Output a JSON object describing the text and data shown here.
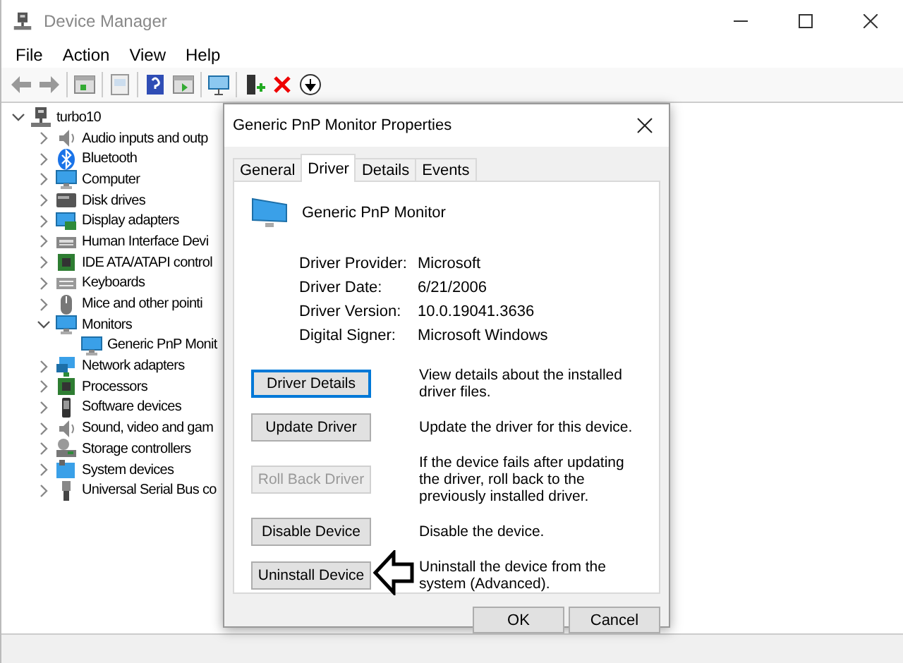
{
  "window": {
    "title": "Device Manager"
  },
  "menu": [
    "File",
    "Action",
    "View",
    "Help"
  ],
  "tree": [
    {
      "label": "turbo10",
      "kind": "computer",
      "expanded": true,
      "children": [
        {
          "label": "Audio inputs and outp",
          "kind": "speaker",
          "expanded": false
        },
        {
          "label": "Bluetooth",
          "kind": "bluetooth",
          "expanded": false
        },
        {
          "label": "Computer",
          "kind": "monitor",
          "expanded": false
        },
        {
          "label": "Disk drives",
          "kind": "disk",
          "expanded": false
        },
        {
          "label": "Display adapters",
          "kind": "adapter",
          "expanded": false
        },
        {
          "label": "Human Interface Devi",
          "kind": "hid",
          "expanded": false
        },
        {
          "label": "IDE ATA/ATAPI control",
          "kind": "chip",
          "expanded": false
        },
        {
          "label": "Keyboards",
          "kind": "keyboard",
          "expanded": false
        },
        {
          "label": "Mice and other pointi",
          "kind": "mouse",
          "expanded": false
        },
        {
          "label": "Monitors",
          "kind": "monitor",
          "expanded": true,
          "children": [
            {
              "label": "Generic PnP Monit",
              "kind": "monitor"
            }
          ]
        },
        {
          "label": "Network adapters",
          "kind": "network",
          "expanded": false
        },
        {
          "label": "Processors",
          "kind": "chip",
          "expanded": false
        },
        {
          "label": "Software devices",
          "kind": "phone",
          "expanded": false
        },
        {
          "label": "Sound, video and gam",
          "kind": "speaker",
          "expanded": false
        },
        {
          "label": "Storage controllers",
          "kind": "storage",
          "expanded": false
        },
        {
          "label": "System devices",
          "kind": "folder",
          "expanded": false
        },
        {
          "label": "Universal Serial Bus co",
          "kind": "usb",
          "expanded": false
        }
      ]
    }
  ],
  "dialog": {
    "title": "Generic PnP Monitor Properties",
    "tabs": [
      {
        "label": "General",
        "selected": false
      },
      {
        "label": "Driver",
        "selected": true
      },
      {
        "label": "Details",
        "selected": false
      },
      {
        "label": "Events",
        "selected": false
      }
    ],
    "device_name": "Generic PnP Monitor",
    "properties": [
      {
        "label": "Driver Provider:",
        "value": "Microsoft"
      },
      {
        "label": "Driver Date:",
        "value": "6/21/2006"
      },
      {
        "label": "Driver Version:",
        "value": "10.0.19041.3636"
      },
      {
        "label": "Digital Signer:",
        "value": "Microsoft Windows"
      }
    ],
    "actions": [
      {
        "button": "Driver Details",
        "description": "View details about the installed driver files.",
        "disabled": false,
        "focused": true
      },
      {
        "button": "Update Driver",
        "description": "Update the driver for this device.",
        "disabled": false,
        "focused": false
      },
      {
        "button": "Roll Back Driver",
        "description": "If the device fails after updating the driver, roll back to the previously installed driver.",
        "disabled": true,
        "focused": false
      },
      {
        "button": "Disable Device",
        "description": "Disable the device.",
        "disabled": false,
        "focused": false
      },
      {
        "button": "Uninstall Device",
        "description": "Uninstall the device from the system (Advanced).",
        "disabled": false,
        "focused": false
      }
    ],
    "buttons": [
      "OK",
      "Cancel"
    ]
  }
}
